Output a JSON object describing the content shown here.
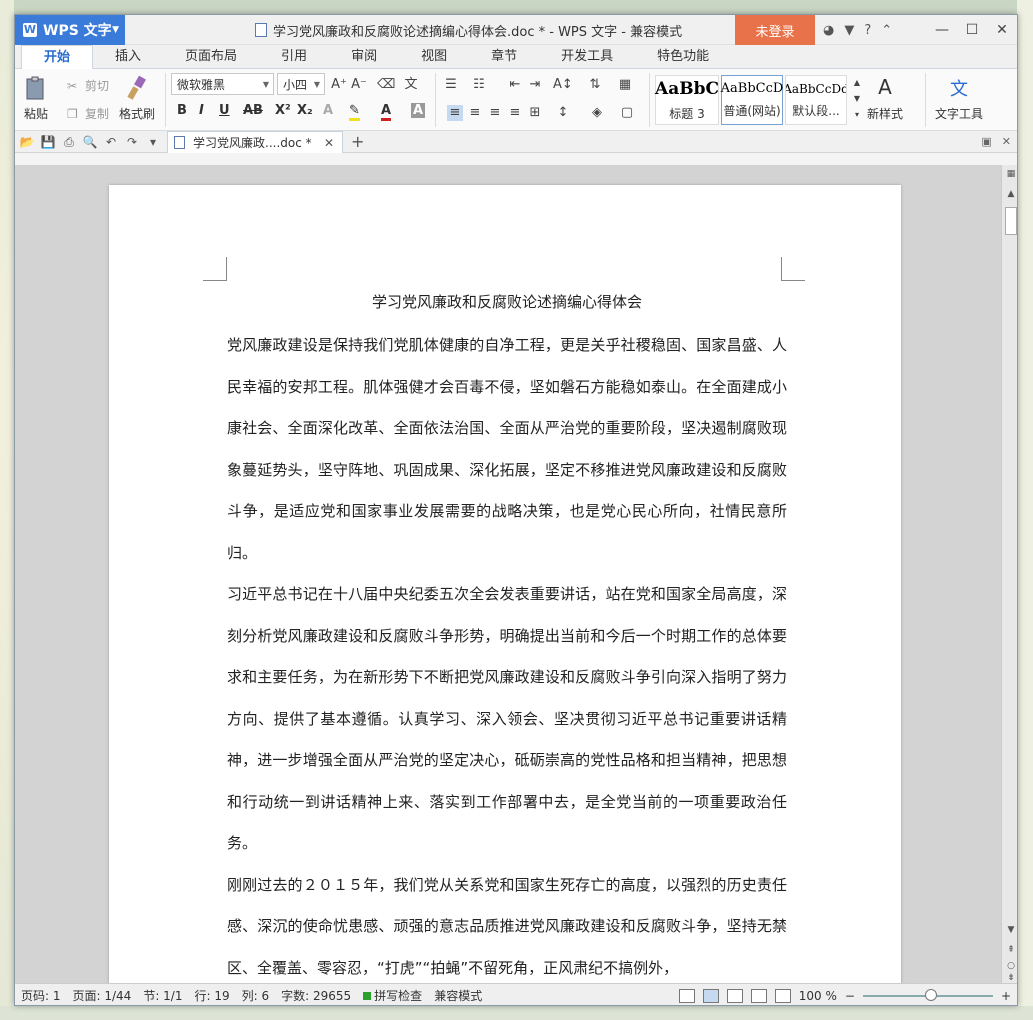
{
  "app": {
    "name": "WPS 文字",
    "dropdown_icon": "chevron-down-icon"
  },
  "title": {
    "text": "学习党风廉政和反腐败论述摘编心得体会.doc * - WPS 文字 - 兼容模式"
  },
  "login": {
    "label": "未登录"
  },
  "window_icons": {
    "minimize": "—",
    "maximize": "☐",
    "close": "✕",
    "help": "?"
  },
  "tabs": [
    "开始",
    "插入",
    "页面布局",
    "引用",
    "审阅",
    "视图",
    "章节",
    "开发工具",
    "特色功能"
  ],
  "ribbon": {
    "paste": "粘贴",
    "cut": "剪切",
    "copy": "复制",
    "format_painter": "格式刷",
    "font_name": "微软雅黑",
    "font_size": "小四",
    "styles": [
      {
        "sample": "AaBbC",
        "name": "标题 3"
      },
      {
        "sample": "AaBbCcD",
        "name": "普通(网站)"
      },
      {
        "sample": "AaBbCcDd",
        "name": "默认段..."
      }
    ],
    "new_style": "新样式",
    "text_tools": "文字工具"
  },
  "doc_tab": {
    "label": "学习党风廉政....doc *",
    "close": "✕",
    "add": "+"
  },
  "document": {
    "heading": "学习党风廉政和反腐败论述摘编心得体会",
    "paragraphs": [
      "党风廉政建设是保持我们党肌体健康的自净工程，更是关乎社稷稳固、国家昌盛、人民幸福的安邦工程。肌体强健才会百毒不侵，坚如磐石方能稳如泰山。在全面建成小康社会、全面深化改革、全面依法治国、全面从严治党的重要阶段，坚决遏制腐败现象蔓延势头，坚守阵地、巩固成果、深化拓展，坚定不移推进党风廉政建设和反腐败斗争，是适应党和国家事业发展需要的战略决策，也是党心民心所向，社情民意所归。",
      "习近平总书记在十八届中央纪委五次全会发表重要讲话，站在党和国家全局高度，深刻分析党风廉政建设和反腐败斗争形势，明确提出当前和今后一个时期工作的总体要求和主要任务，为在新形势下不断把党风廉政建设和反腐败斗争引向深入指明了努力方向、提供了基本遵循。认真学习、深入领会、坚决贯彻习近平总书记重要讲话精神，进一步增强全面从严治党的坚定决心，砥砺崇高的党性品格和担当精神，把思想和行动统一到讲话精神上来、落实到工作部署中去，是全党当前的一项重要政治任务。",
      "刚刚过去的２０１５年，我们党从关系党和国家生死存亡的高度，以强烈的历史责任感、深沉的使命忧患感、顽强的意志品质推进党风廉政建设和反腐败斗争，坚持无禁区、全覆盖、零容忍，“打虎”“拍蝇”不留死角，正风肃纪不搞例外，"
    ]
  },
  "status": {
    "page": "页码: 1",
    "pages": "页面: 1/44",
    "section": "节: 1/1",
    "row": "行: 19",
    "col": "列: 6",
    "words": "字数: 29655",
    "spell": "拼写检查",
    "mode": "兼容模式",
    "zoom": "100 %",
    "zoom_level": 1.0
  }
}
